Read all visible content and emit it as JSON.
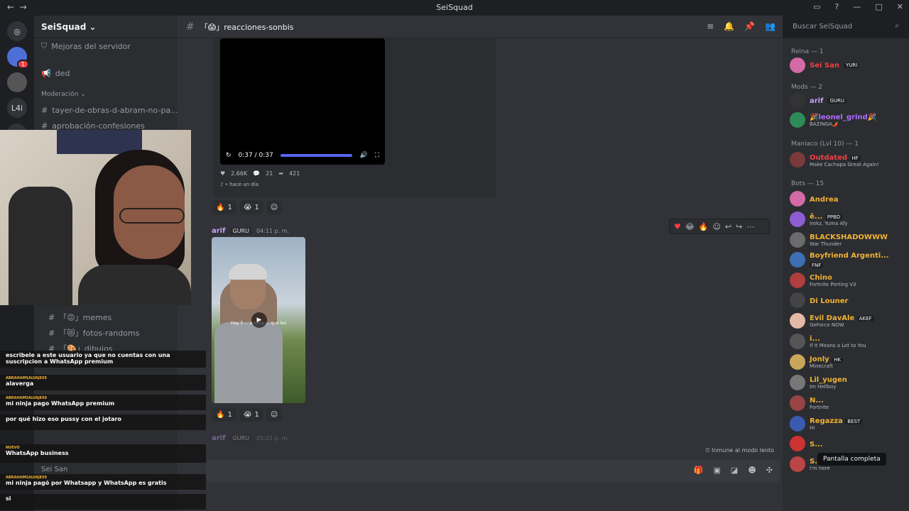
{
  "window": {
    "title": "SeiSquad"
  },
  "server": {
    "name": "SeiSquad",
    "search_placeholder": "Buscar SeiSquad"
  },
  "server_list": [
    {
      "label": "",
      "badge": "1"
    },
    {
      "label": "",
      "badge": ""
    },
    {
      "label": "L4i",
      "badge": ""
    },
    {
      "label": "M",
      "badge": ""
    }
  ],
  "channels": {
    "top": [
      {
        "label": "Mejoras del servidor"
      },
      {
        "label": "ded"
      }
    ],
    "category": "Moderación",
    "mod_items": [
      {
        "label": "tayer-de-obras-d-abram-no-pa..."
      },
      {
        "label": "aprobación-confesiones"
      }
    ],
    "bottom": [
      {
        "label": "「😡」memes"
      },
      {
        "label": "「😻」fotos-randoms"
      },
      {
        "label": "「🎨」dibujos"
      }
    ],
    "user": "Sei San"
  },
  "channel": {
    "name": "「😱」reacciones-sonbis"
  },
  "video1": {
    "time": "0:37 / 0:37"
  },
  "embed": {
    "likes": "2.66K",
    "comments": "21",
    "shares": "421",
    "source": "hace un día"
  },
  "reactions1": [
    {
      "emoji": "🔥",
      "count": "1"
    },
    {
      "emoji": "😭",
      "count": "1"
    }
  ],
  "message": {
    "author": "arif",
    "tag": "GURU",
    "time": "04:11 p. m."
  },
  "video2": {
    "caption": "Hay 5 ... a hace ... que les"
  },
  "reactions2": [
    {
      "emoji": "🔥",
      "count": "1"
    },
    {
      "emoji": "😭",
      "count": "1"
    }
  ],
  "message2": {
    "author": "arif",
    "tag": "GURU",
    "time": "05:22 p. m."
  },
  "slowmode": "Inmune al modo lento",
  "members": {
    "categories": [
      "Reina — 1",
      "Mods — 2",
      "Maniaco (Lvl 10) — 1",
      "Bots — 15"
    ],
    "reina": [
      {
        "name": "Sei San",
        "tag": "YURI",
        "color": "#f23f43",
        "sub": ""
      }
    ],
    "mods": [
      {
        "name": "arif",
        "tag": "GURU",
        "color": "#c9a0ff",
        "sub": ""
      },
      {
        "name": "🎉leonel_grind🎉",
        "tag": "",
        "color": "#b06cff",
        "sub": "BAZINGA🌶️"
      }
    ],
    "maniaco": [
      {
        "name": "Outdated",
        "tag": "HF",
        "color": "#f23f43",
        "sub": "Make Cachapa Great Again!"
      }
    ],
    "bots": [
      {
        "name": "Andrea",
        "tag": "",
        "color": "#f0b232",
        "sub": ""
      },
      {
        "name": "ê...",
        "tag": "PPBD",
        "color": "#f0b232",
        "sub": "Irokz, Yuma Afy"
      },
      {
        "name": "BLACKSHADOWWW",
        "tag": "",
        "color": "#f0b232",
        "sub": "War Thunder"
      },
      {
        "name": "Boyfriend Argenti...",
        "tag": "FNF",
        "color": "#f0b232",
        "sub": ""
      },
      {
        "name": "Chino",
        "tag": "",
        "color": "#f0b232",
        "sub": "Fortnite Porting V3"
      },
      {
        "name": "Di Louner",
        "tag": "",
        "color": "#f0b232",
        "sub": ""
      },
      {
        "name": "Evil DavAle",
        "tag": "AKEF",
        "color": "#f0b232",
        "sub": "GeForce NOW"
      },
      {
        "name": "i...",
        "tag": "",
        "color": "#f0b232",
        "sub": "If It Means a Lot to You"
      },
      {
        "name": "Jonly",
        "tag": "HK",
        "color": "#f0b232",
        "sub": "Minecraft"
      },
      {
        "name": "Lil_yugen",
        "tag": "",
        "color": "#f0b232",
        "sub": "Im Hellboy"
      },
      {
        "name": "N...",
        "tag": "",
        "color": "#f0b232",
        "sub": "Fortnite"
      },
      {
        "name": "Regazza",
        "tag": "BEST",
        "color": "#f0b232",
        "sub": "Hi"
      },
      {
        "name": "S...",
        "tag": "",
        "color": "#f0b232",
        "sub": ""
      },
      {
        "name": "S...",
        "tag": "SUNS",
        "color": "#f0b232",
        "sub": "I'm here"
      }
    ]
  },
  "tooltip": "Pantalla completa",
  "chat": [
    {
      "user": "",
      "text": "escribele a este usuario ya que no cuentas con una suscripcion a WhatsApp premium"
    },
    {
      "user": "ABRAHAMSALVAJE69",
      "text": "alaverga"
    },
    {
      "user": "ABRAHAMSALVAJE69",
      "text": "mi ninja pago WhatsApp premium"
    },
    {
      "user": "",
      "text": "por qué hizo eso pussy con el jotaro"
    },
    {
      "user": "NUEVO",
      "text": "WhatsApp business"
    },
    {
      "user": "ABRAHAMSALVAJE69",
      "text": "mi ninja pagó por Whatsapp y WhatsApp es gratis"
    },
    {
      "user": "",
      "text": "si"
    }
  ]
}
